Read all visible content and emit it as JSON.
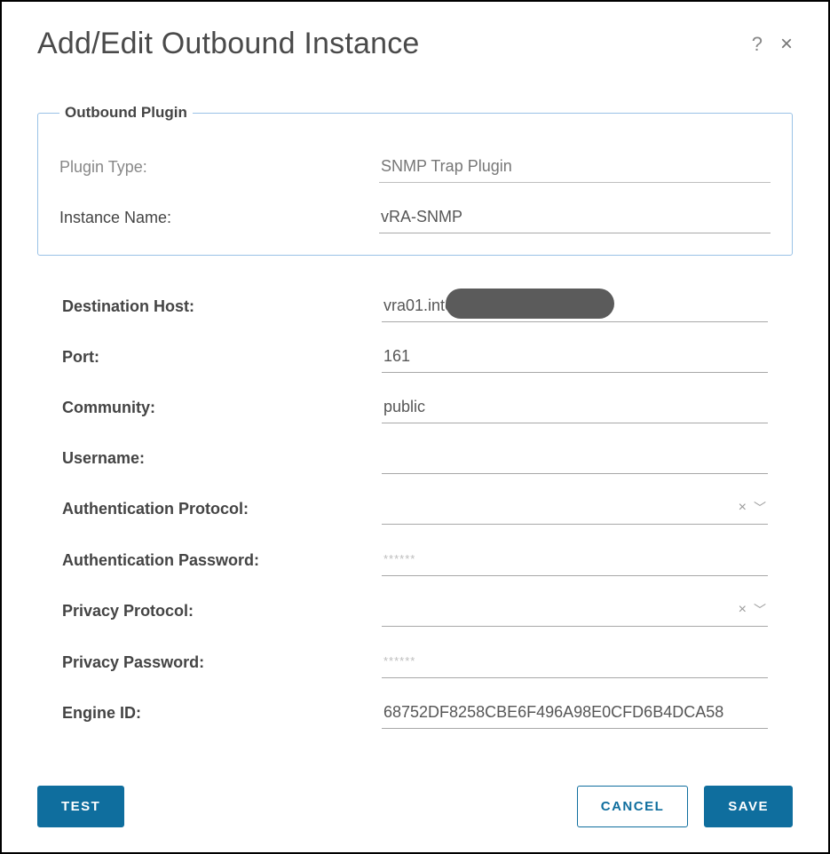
{
  "dialog": {
    "title": "Add/Edit Outbound Instance",
    "help_tooltip": "?",
    "close_label": "×"
  },
  "plugin_group": {
    "legend": "Outbound Plugin",
    "plugin_type_label": "Plugin Type:",
    "plugin_type_value": "SNMP Trap Plugin",
    "instance_name_label": "Instance Name:",
    "instance_name_value": "vRA-SNMP"
  },
  "fields": {
    "destination_host": {
      "label": "Destination Host:",
      "value": "vra01.inte"
    },
    "port": {
      "label": "Port:",
      "value": "161"
    },
    "community": {
      "label": "Community:",
      "value": "public"
    },
    "username": {
      "label": "Username:",
      "value": ""
    },
    "auth_protocol": {
      "label": "Authentication Protocol:",
      "value": ""
    },
    "auth_password": {
      "label": "Authentication Password:",
      "value": "",
      "placeholder": "******"
    },
    "priv_protocol": {
      "label": "Privacy Protocol:",
      "value": ""
    },
    "priv_password": {
      "label": "Privacy Password:",
      "value": "",
      "placeholder": "******"
    },
    "engine_id": {
      "label": "Engine ID:",
      "value": "68752DF8258CBE6F496A98E0CFD6B4DCA58"
    }
  },
  "icons": {
    "clear": "×",
    "chevron_down": "﹀"
  },
  "buttons": {
    "test": "TEST",
    "cancel": "CANCEL",
    "save": "SAVE"
  }
}
